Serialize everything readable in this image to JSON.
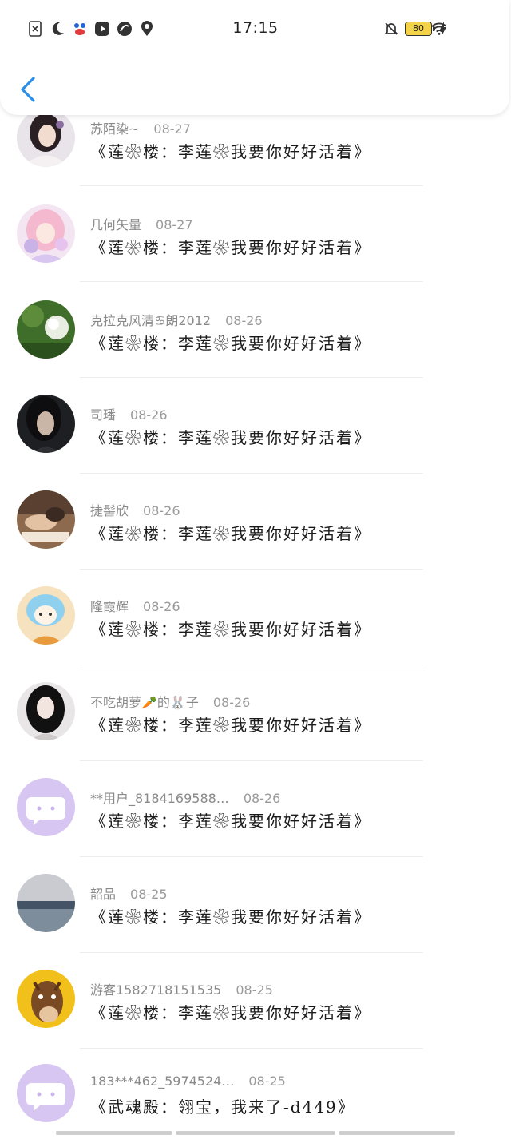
{
  "status_bar": {
    "time": "17:15",
    "battery": "80",
    "left_icons": [
      "close-box-icon",
      "moon-icon",
      "paw-app-icon",
      "video-app-icon",
      "leaf-app-icon",
      "location-du-icon"
    ],
    "right_icons": [
      "bell-off-icon",
      "moon-icon",
      "wifi-icon",
      "battery-icon",
      "charging-icon"
    ]
  },
  "accent_color": "#2b8fe6",
  "comments": [
    {
      "user": "苏陌染~",
      "date": "08-27",
      "text": "《莲❀楼：李莲❀我要你好好活着》",
      "avatar": "portrait-woman-hanfu"
    },
    {
      "user": "几何矢量",
      "date": "08-27",
      "text": "《莲❀楼：李莲❀我要你好好活着》",
      "avatar": "anime-girl-pink"
    },
    {
      "user": "克拉克风清♋朗2012",
      "date": "08-26",
      "text": "《莲❀楼：李莲❀我要你好好活着》",
      "avatar": "white-flower"
    },
    {
      "user": "司璠",
      "date": "08-26",
      "text": "《莲❀楼：李莲❀我要你好好活着》",
      "avatar": "portrait-dark"
    },
    {
      "user": "捷髻欣",
      "date": "08-26",
      "text": "《莲❀楼：李莲❀我要你好好活着》",
      "avatar": "sleeping-person"
    },
    {
      "user": "隆霞辉",
      "date": "08-26",
      "text": "《莲❀楼：李莲❀我要你好好活着》",
      "avatar": "cartoon-blue-hair"
    },
    {
      "user": "不吃胡萝🥕的🐰子",
      "date": "08-26",
      "text": "《莲❀楼：李莲❀我要你好好活着》",
      "avatar": "portrait-black-hair"
    },
    {
      "user": "**用户_8184169588…",
      "date": "08-26",
      "text": "《莲❀楼：李莲❀我要你好好活着》",
      "avatar": "default-chat"
    },
    {
      "user": "韶品",
      "date": "08-25",
      "text": "《莲❀楼：李莲❀我要你好好活着》",
      "avatar": "sea-landscape"
    },
    {
      "user": "游客1582718151535",
      "date": "08-25",
      "text": "《莲❀楼：李莲❀我要你好好活着》",
      "avatar": "cartoon-horse"
    },
    {
      "user": "183***462_5974524…",
      "date": "08-25",
      "text": "《武魂殿：翎宝，我来了-d449》",
      "avatar": "default-chat"
    }
  ]
}
